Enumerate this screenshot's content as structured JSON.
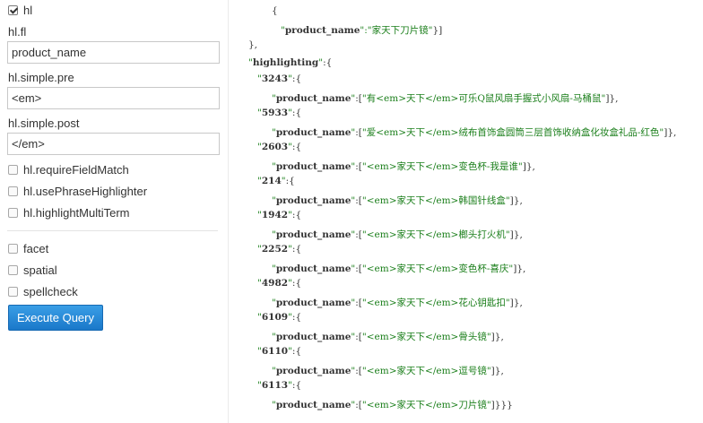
{
  "left_panel": {
    "hl": {
      "label": "hl",
      "checked": true
    },
    "hl_fl": {
      "label": "hl.fl",
      "value": "product_name"
    },
    "hl_simple_pre": {
      "label": "hl.simple.pre",
      "value": "<em>"
    },
    "hl_simple_post": {
      "label": "hl.simple.post",
      "value": "</em>"
    },
    "hl_options": [
      {
        "label": "hl.requireFieldMatch",
        "checked": false
      },
      {
        "label": "hl.usePhraseHighlighter",
        "checked": false
      },
      {
        "label": "hl.highlightMultiTerm",
        "checked": false
      }
    ],
    "extra_options": [
      {
        "label": "facet",
        "checked": false
      },
      {
        "label": "spatial",
        "checked": false
      },
      {
        "label": "spellcheck",
        "checked": false
      }
    ],
    "execute_button": "Execute Query"
  },
  "response": {
    "open_brace": "{",
    "last_doc": {
      "field": "product_name",
      "value": "家天下刀片镜"
    },
    "highlighting_key": "highlighting",
    "highlighting_field": "product_name",
    "highlights": [
      {
        "id": "3243",
        "text": "有<em>天下</em>可乐Q鼠风扇手握式小风扇-马桶鼠"
      },
      {
        "id": "5933",
        "text": "爱<em>天下</em>绒布首饰盒圆筒三层首饰收纳盒化妆盒礼品-红色"
      },
      {
        "id": "2603",
        "text": "<em>家天下</em>变色杯-我是谁"
      },
      {
        "id": "214",
        "text": "<em>家天下</em>韩国针线盒"
      },
      {
        "id": "1942",
        "text": "<em>家天下</em>榔头打火机"
      },
      {
        "id": "2252",
        "text": "<em>家天下</em>变色杯-喜庆"
      },
      {
        "id": "4982",
        "text": "<em>家天下</em>花心钥匙扣"
      },
      {
        "id": "6109",
        "text": "<em>家天下</em>骨头镜"
      },
      {
        "id": "6110",
        "text": "<em>家天下</em>逗号镜"
      },
      {
        "id": "6113",
        "text": "<em>家天下</em>刀片镜"
      }
    ]
  }
}
